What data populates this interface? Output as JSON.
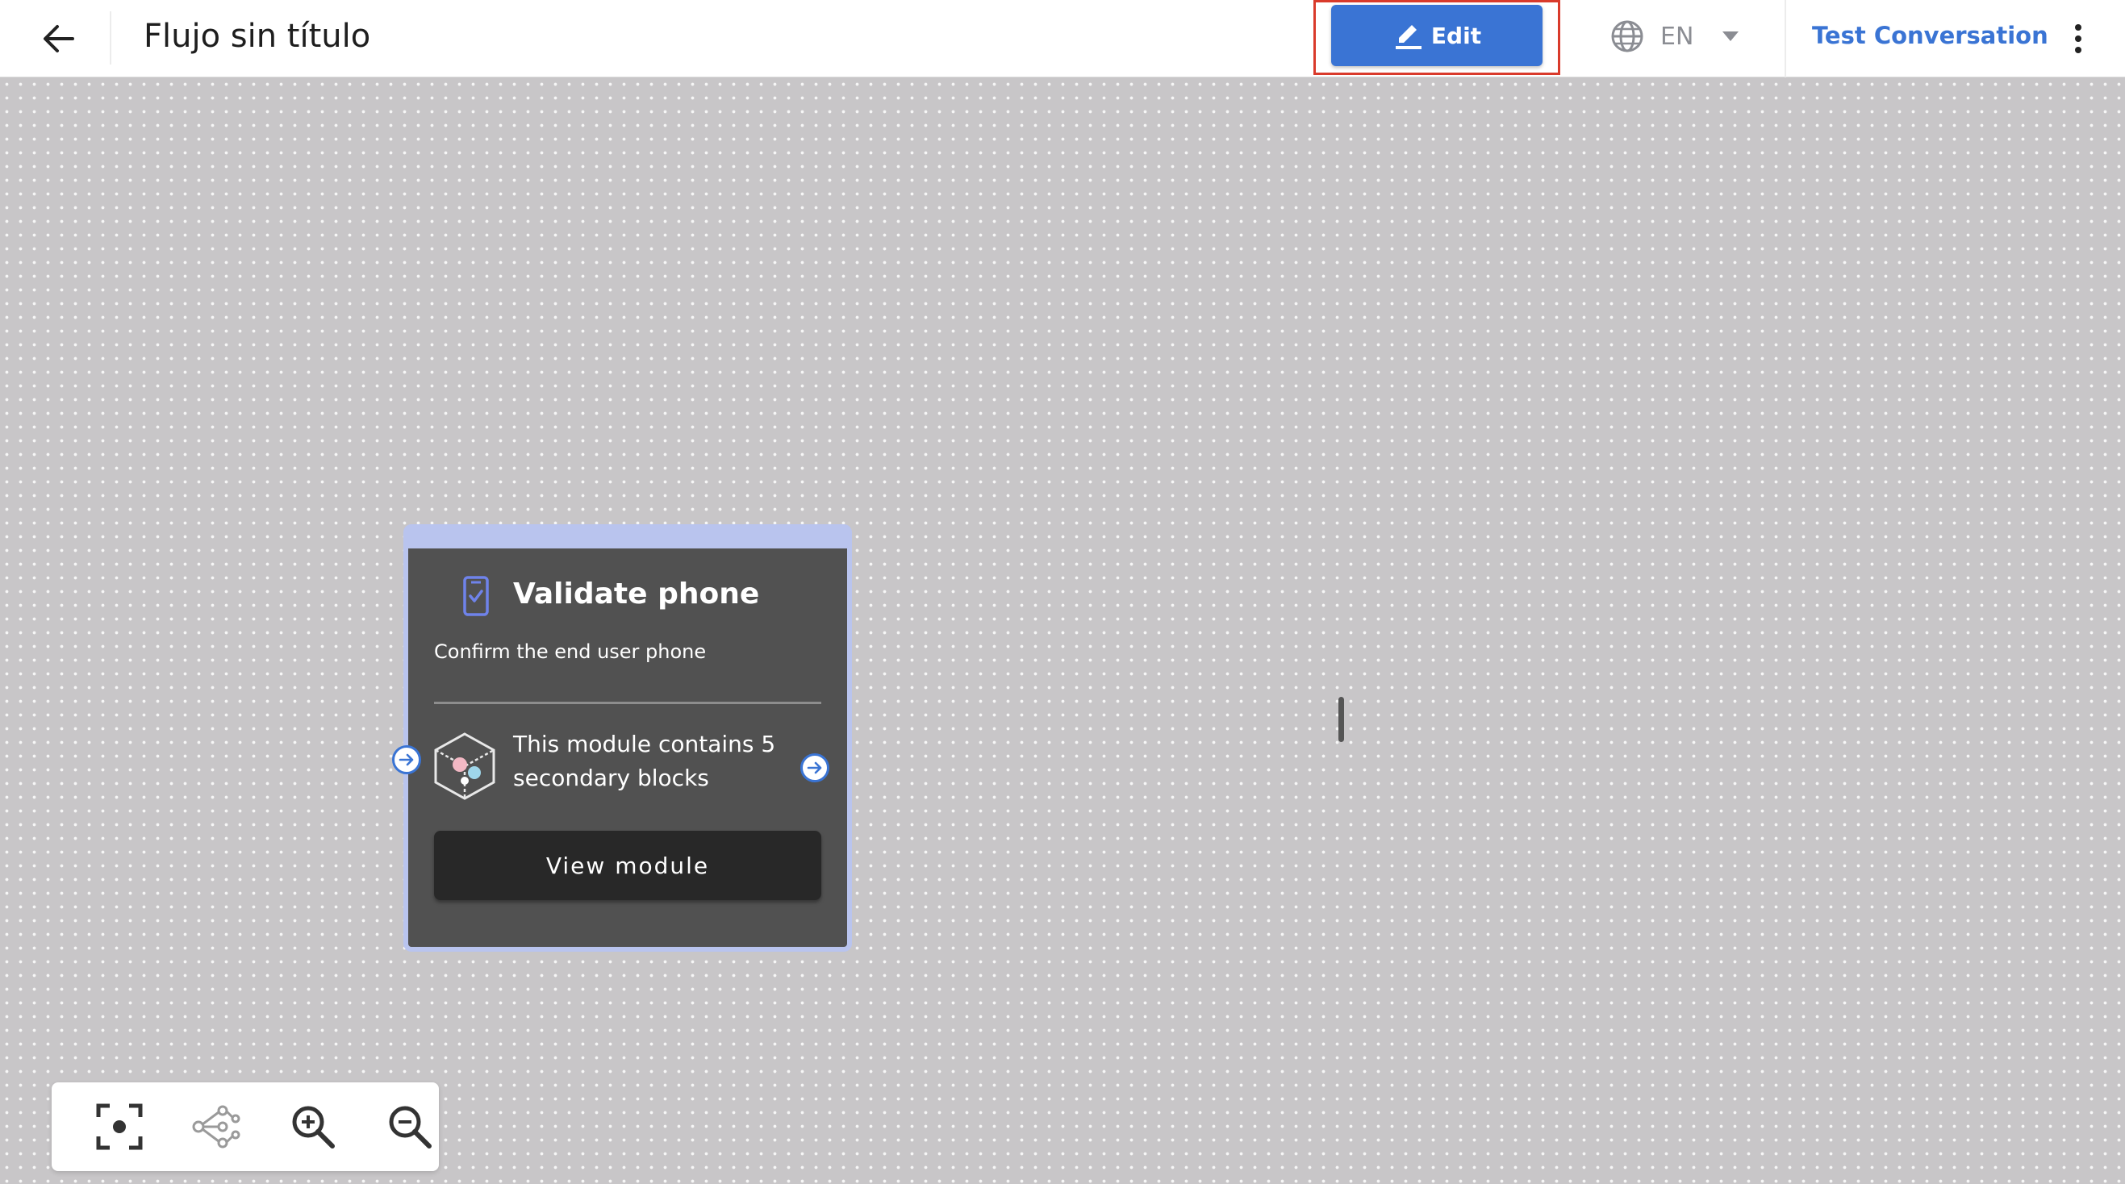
{
  "header": {
    "title": "Flujo sin título",
    "edit_label": "Edit",
    "language": "EN",
    "test_conversation_label": "Test Conversation"
  },
  "module_card": {
    "title": "Validate phone",
    "description": "Confirm the end user phone",
    "info": "This module contains 5 secondary blocks",
    "view_button_label": "View module"
  },
  "icons": {
    "back": "arrow-left-icon",
    "edit": "pencil-icon",
    "language": "globe-icon",
    "language_caret": "caret-down-icon",
    "more": "more-vertical-icon",
    "card": "phone-check-icon",
    "module": "cube-icon",
    "toolbar": [
      "focus-icon",
      "share-icon",
      "zoom-in-icon",
      "zoom-out-icon"
    ]
  },
  "colors": {
    "primary": "#3a74d4",
    "highlight": "#d93a2b",
    "card_bg": "#515151",
    "card_border": "#b9c4ee",
    "canvas_bg": "#c8c6c8"
  }
}
